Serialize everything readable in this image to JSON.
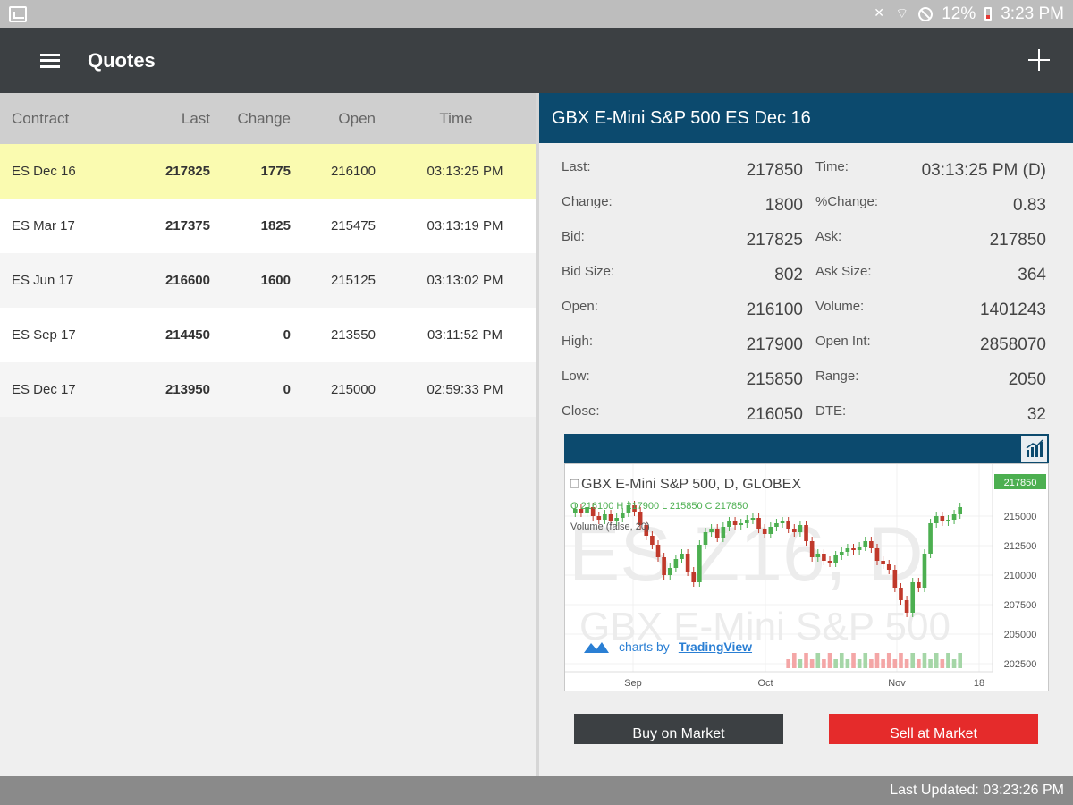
{
  "statusbar": {
    "battery": "12%",
    "clock": "3:23 PM"
  },
  "appbar": {
    "title": "Quotes"
  },
  "quotes": {
    "columns": {
      "contract": "Contract",
      "last": "Last",
      "change": "Change",
      "open": "Open",
      "time": "Time"
    },
    "rows": [
      {
        "contract": "ES Dec 16",
        "last": "217825",
        "change": "1775",
        "open": "216100",
        "time": "03:13:25 PM"
      },
      {
        "contract": "ES Mar 17",
        "last": "217375",
        "change": "1825",
        "open": "215475",
        "time": "03:13:19 PM"
      },
      {
        "contract": "ES Jun 17",
        "last": "216600",
        "change": "1600",
        "open": "215125",
        "time": "03:13:02 PM"
      },
      {
        "contract": "ES Sep 17",
        "last": "214450",
        "change": "0",
        "open": "213550",
        "time": "03:11:52 PM"
      },
      {
        "contract": "ES Dec 17",
        "last": "213950",
        "change": "0",
        "open": "215000",
        "time": "02:59:33 PM"
      }
    ]
  },
  "detail": {
    "title": "GBX E-Mini S&P 500 ES Dec 16",
    "left": [
      {
        "label": "Last:",
        "value": "217850"
      },
      {
        "label": "Change:",
        "value": "1800"
      },
      {
        "label": "Bid:",
        "value": "217825"
      },
      {
        "label": "Bid Size:",
        "value": "802"
      },
      {
        "label": "Open:",
        "value": "216100"
      },
      {
        "label": "High:",
        "value": "217900"
      },
      {
        "label": "Low:",
        "value": "215850"
      },
      {
        "label": "Close:",
        "value": "216050"
      }
    ],
    "right": [
      {
        "label": "Time:",
        "value": "03:13:25 PM (D)"
      },
      {
        "label": "%Change:",
        "value": "0.83"
      },
      {
        "label": "Ask:",
        "value": "217850"
      },
      {
        "label": "Ask Size:",
        "value": "364"
      },
      {
        "label": "Volume:",
        "value": "1401243"
      },
      {
        "label": "Open Int:",
        "value": "2858070"
      },
      {
        "label": "Range:",
        "value": "2050"
      },
      {
        "label": "DTE:",
        "value": "32"
      }
    ]
  },
  "chart": {
    "legend_title": "GBX E-Mini S&P 500, D, GLOBEX",
    "watermark_symbol": "ES Z16, D",
    "watermark_name": "GBX E-Mini S&P 500",
    "ohlc_line": "O 216100 H 217900 L 215850 C 217850",
    "volume_line": "Volume (false, 20)",
    "attribution": "charts by",
    "attribution_link": "TradingView",
    "last_price_label": "217850",
    "y_ticks": [
      "215000",
      "212500",
      "210000",
      "207500",
      "205000",
      "202500"
    ],
    "x_ticks": [
      "Sep",
      "Oct",
      "Nov",
      "18"
    ],
    "up_color": "#4caf50",
    "down_color": "#c0392b"
  },
  "actions": {
    "buy": "Buy on Market",
    "sell": "Sell at Market"
  },
  "footer": {
    "last_updated": "Last Updated: 03:23:26 PM"
  }
}
